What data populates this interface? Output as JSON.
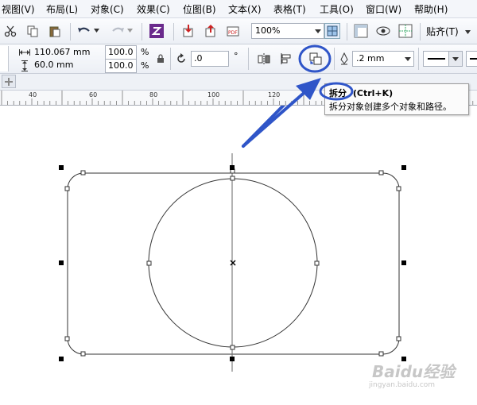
{
  "menubar": {
    "items": [
      {
        "label": "视图(V)"
      },
      {
        "label": "布局(L)"
      },
      {
        "label": "对象(C)"
      },
      {
        "label": "效果(C)"
      },
      {
        "label": "位图(B)"
      },
      {
        "label": "文本(X)"
      },
      {
        "label": "表格(T)"
      },
      {
        "label": "工具(O)"
      },
      {
        "label": "窗口(W)"
      },
      {
        "label": "帮助(H)"
      }
    ]
  },
  "toolbar": {
    "zoom_value": "100%",
    "snap_label": "贴齐(T)"
  },
  "propbar": {
    "width_value": "110.067 mm",
    "height_value": "60.0 mm",
    "scale_x": "100.0",
    "scale_y": "100.0",
    "percent_symbol": "%",
    "rotation_value": ".0",
    "degree_symbol": "°",
    "outline_width": ".2 mm"
  },
  "ruler": {
    "ticks": [
      "40",
      "60",
      "80",
      "100",
      "120"
    ]
  },
  "tooltip": {
    "title": "拆分",
    "shortcut": "(Ctrl+K)",
    "description": "拆分对象创建多个对象和路径。"
  },
  "watermark": {
    "text": "Baidu经验",
    "url": "jingyan.baidu.com"
  },
  "colors": {
    "highlight": "#2f55c8",
    "menubar_bg": "#f4f6fa",
    "shape_stroke": "#333333"
  }
}
